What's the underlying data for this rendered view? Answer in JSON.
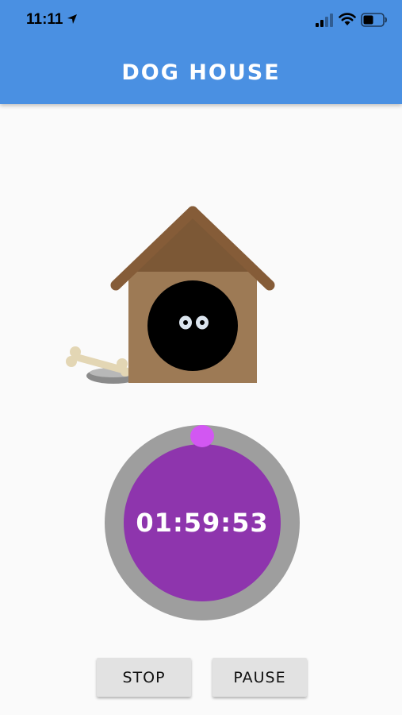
{
  "status_bar": {
    "time": "11:11",
    "icons": [
      "location-arrow-icon",
      "cellular-signal-icon",
      "wifi-icon",
      "battery-icon"
    ]
  },
  "header": {
    "title": "DOG HOUSE",
    "background_color": "#4a90e2"
  },
  "illustration": {
    "icon": "dog-house-icon",
    "bone_icon": "bone-in-bowl-icon"
  },
  "timer": {
    "display": "01:59:53",
    "face_color": "#8e35ad",
    "ring_color": "#9e9e9e",
    "knob_color": "#d257f2"
  },
  "controls": {
    "stop_label": "STOP",
    "pause_label": "PAUSE"
  }
}
